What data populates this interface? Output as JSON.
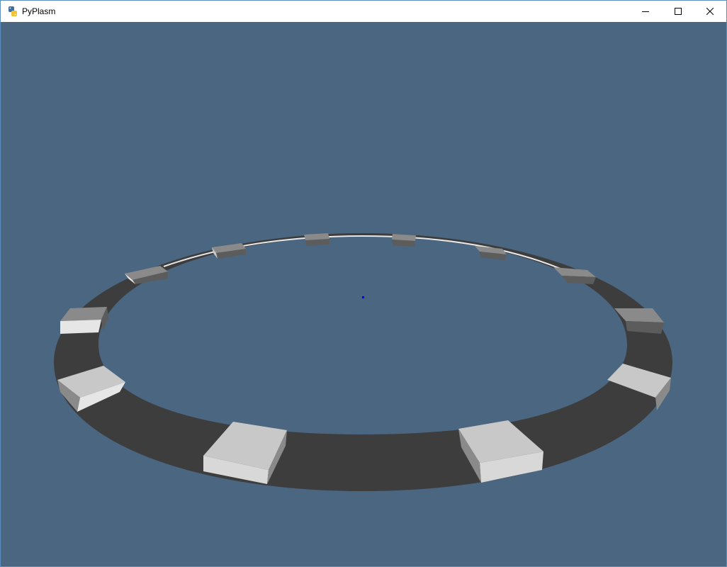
{
  "window": {
    "title": "PyPlasm",
    "app_icon": "python-icon",
    "controls": {
      "minimize_icon": "minimize-icon",
      "maximize_icon": "maximize-icon",
      "close_icon": "close-icon"
    }
  },
  "viewport": {
    "background_color": "#4a6680",
    "scene": "ring-of-blocks"
  },
  "colors": {
    "ring_dark": "#3d3d3d",
    "block_light": "#c8c8c8",
    "block_mid": "#8a8a8a",
    "block_dark": "#5c5c5c"
  }
}
